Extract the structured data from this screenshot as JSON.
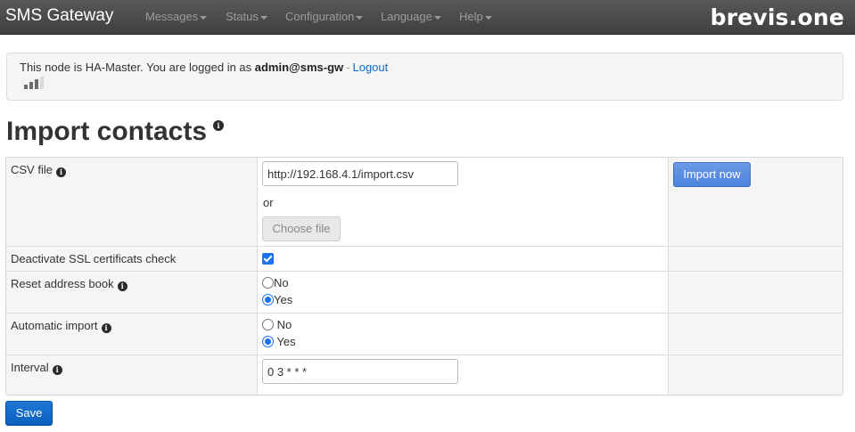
{
  "navbar": {
    "brand": "SMS Gateway",
    "menu": [
      {
        "label": "Messages"
      },
      {
        "label": "Status"
      },
      {
        "label": "Configuration"
      },
      {
        "label": "Language"
      },
      {
        "label": "Help"
      }
    ],
    "logo": "brevis.one"
  },
  "status": {
    "prefix": "This node is HA-Master. You are logged in as ",
    "user": "admin@sms-gw",
    "separator": "-",
    "logout": "Logout",
    "signal_level": 3,
    "signal_bars": 4
  },
  "page": {
    "title": "Import contacts",
    "info_icon": "info-icon"
  },
  "form": {
    "csv_file": {
      "label": "CSV file",
      "url_value": "http://192.168.4.1/import.csv",
      "or_text": "or",
      "choose_label": "Choose file",
      "import_label": "Import now"
    },
    "ssl": {
      "label": "Deactivate SSL certificats check",
      "checked": true
    },
    "reset": {
      "label": "Reset address book",
      "options": [
        "No",
        "Yes"
      ],
      "selected": "Yes"
    },
    "auto_import": {
      "label": "Automatic import",
      "options": [
        "No",
        "Yes"
      ],
      "selected": "Yes"
    },
    "interval": {
      "label": "Interval",
      "value": "0 3 * * *"
    },
    "save_label": "Save"
  },
  "colors": {
    "navbar": "#4a4a4a",
    "primary": "#0b5fbf",
    "import_button": "#5a8de0",
    "link": "#0a6ec4"
  }
}
